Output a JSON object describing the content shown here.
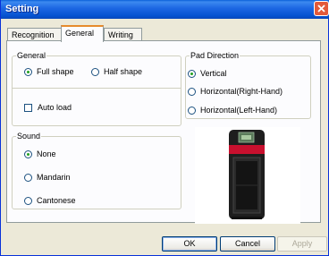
{
  "window": {
    "title": "Setting"
  },
  "tabs": [
    {
      "label": "Recognition",
      "active": false
    },
    {
      "label": "General",
      "active": true
    },
    {
      "label": "Writing",
      "active": false
    }
  ],
  "general": {
    "label": "General",
    "options": [
      {
        "label": "Full shape",
        "selected": true
      },
      {
        "label": "Half shape",
        "selected": false
      }
    ],
    "auto_load": {
      "label": "Auto load",
      "checked": false
    }
  },
  "pad_direction": {
    "label": "Pad Direction",
    "options": [
      {
        "label": "Vertical",
        "selected": true
      },
      {
        "label": "Horizontal(Right-Hand)",
        "selected": false
      },
      {
        "label": "Horizontal(Left-Hand)",
        "selected": false
      }
    ]
  },
  "sound": {
    "label": "Sound",
    "options": [
      {
        "label": "None",
        "selected": true
      },
      {
        "label": "Mandarin",
        "selected": false
      },
      {
        "label": "Cantonese",
        "selected": false
      }
    ]
  },
  "buttons": {
    "ok": "OK",
    "cancel": "Cancel",
    "apply": "Apply"
  },
  "colors": {
    "title_bar": "#0a5fd8",
    "close": "#e35a3a",
    "tab_highlight": "#e68b2c",
    "device": "#222222",
    "device_band": "#c8102e"
  }
}
